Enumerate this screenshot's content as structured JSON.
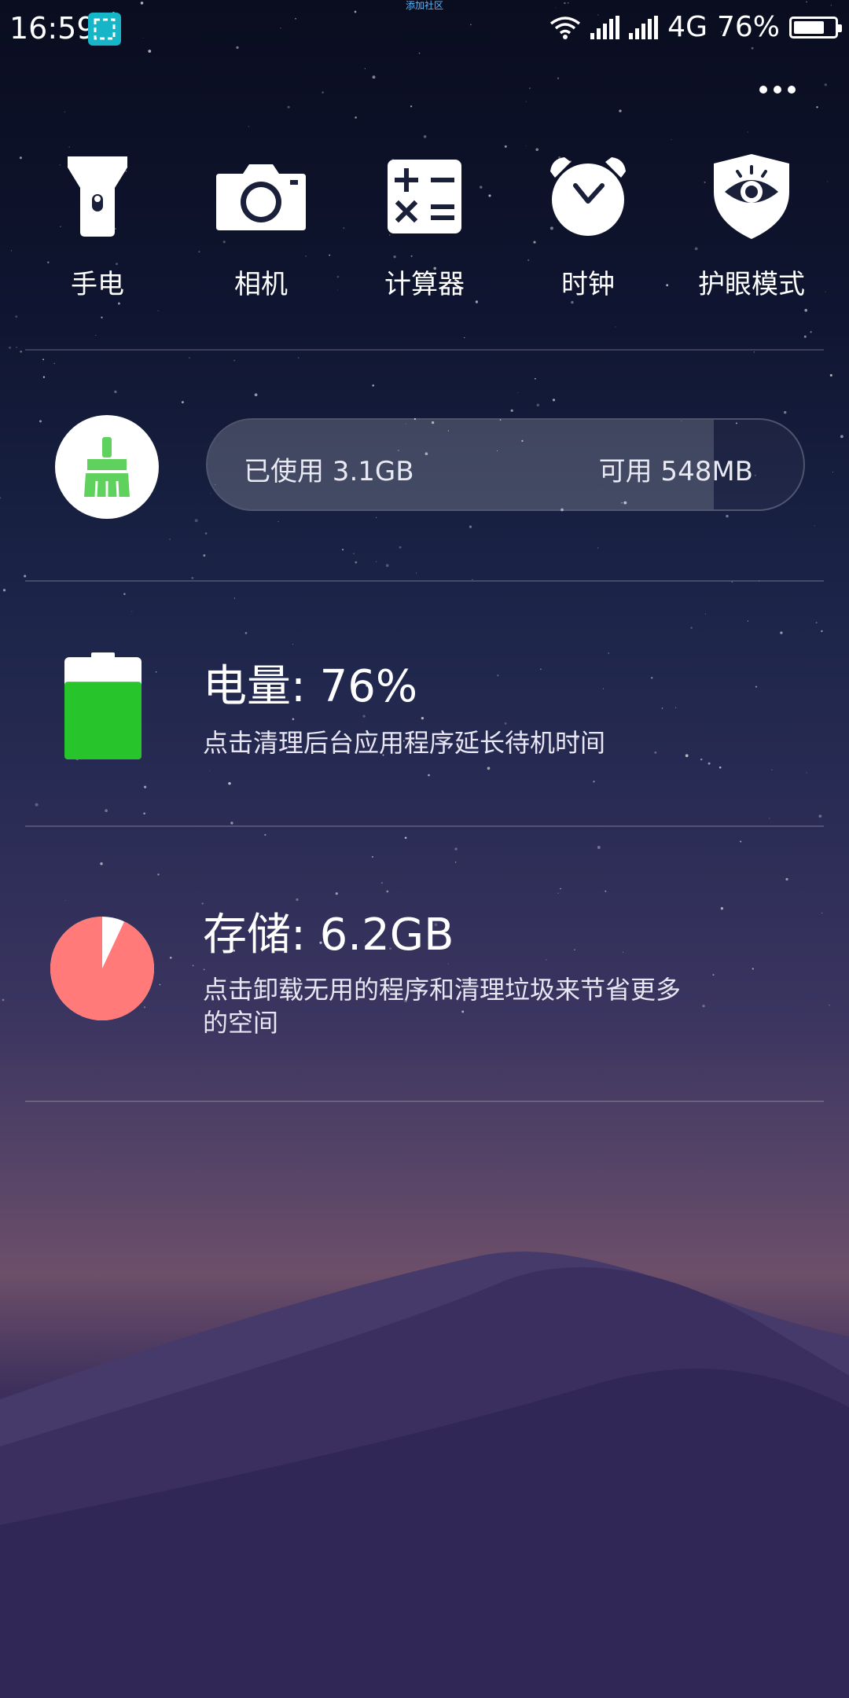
{
  "status_bar": {
    "time": "16:59",
    "network_type": "4G",
    "battery_text": "76%",
    "top_caption": "添加社区"
  },
  "shortcuts": [
    {
      "label": "手电",
      "icon": "flashlight-icon"
    },
    {
      "label": "相机",
      "icon": "camera-icon"
    },
    {
      "label": "计算器",
      "icon": "calculator-icon"
    },
    {
      "label": "时钟",
      "icon": "clock-icon"
    },
    {
      "label": "护眼模式",
      "icon": "eye-protection-icon"
    }
  ],
  "memory": {
    "used_label": "已使用 3.1GB",
    "free_label": "可用 548MB",
    "used_fraction": 0.85
  },
  "battery": {
    "title": "电量: 76%",
    "subtitle": "点击清理后台应用程序延长待机时间",
    "level": 0.76,
    "color": "#27c42b"
  },
  "storage": {
    "title": "存储: 6.2GB",
    "subtitle": "点击卸载无用的程序和清理垃圾来节省更多的空间",
    "used_fraction": 0.93,
    "color": "#ff7a78"
  }
}
